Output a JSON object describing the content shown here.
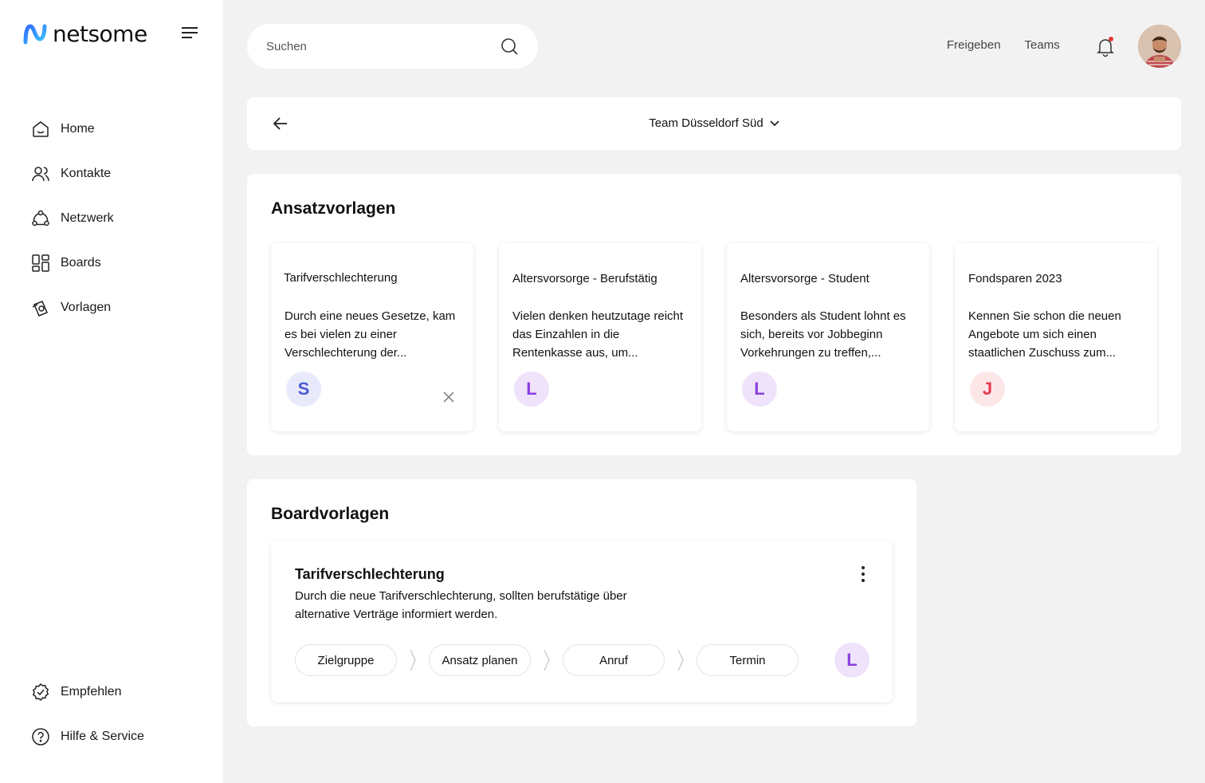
{
  "brand": {
    "name": "netsome"
  },
  "sidebar": {
    "items": [
      {
        "label": "Home",
        "icon": "home-icon"
      },
      {
        "label": "Kontakte",
        "icon": "contacts-icon"
      },
      {
        "label": "Netzwerk",
        "icon": "network-icon"
      },
      {
        "label": "Boards",
        "icon": "boards-icon"
      },
      {
        "label": "Vorlagen",
        "icon": "templates-icon"
      }
    ],
    "bottom_items": [
      {
        "label": "Empfehlen",
        "icon": "recommend-icon"
      },
      {
        "label": "Hilfe & Service",
        "icon": "help-icon"
      }
    ]
  },
  "search": {
    "placeholder": "Suchen"
  },
  "topnav": {
    "share": "Freigeben",
    "teams": "Teams"
  },
  "team": {
    "name": "Team Düsseldorf Süd"
  },
  "approach_templates": {
    "title": "Ansatzvorlagen",
    "cards": [
      {
        "title": "Tarifverschlechterung",
        "text": "Durch eine neues Gesetze, kam es bei vielen zu einer Verschlechterung der...",
        "initial": "S",
        "initial_color": "#4a5bd4",
        "initial_bg": "#e8eafb"
      },
      {
        "title": "Altersvorsorge - Berufstätig",
        "text": "Vielen denken heutzutage reicht das Einzahlen in die Rentenkasse aus, um...",
        "initial": "L",
        "initial_color": "#8a3ee0",
        "initial_bg": "#efe3fb"
      },
      {
        "title": "Altersvorsorge - Student",
        "text": "Besonders als Student lohnt es sich, bereits vor Jobbeginn Vorkehrungen zu treffen,...",
        "initial": "L",
        "initial_color": "#8a3ee0",
        "initial_bg": "#efe3fb"
      },
      {
        "title": "Fondsparen 2023",
        "text": "Kennen Sie schon die neuen Angebote um sich einen staatlichen Zuschuss zum...",
        "initial": "J",
        "initial_color": "#e5394d",
        "initial_bg": "#fde6e8"
      }
    ]
  },
  "board_templates": {
    "title": "Boardvorlagen",
    "board": {
      "title": "Tarifverschlechterung",
      "description": "Durch die neue Tarifverschlechterung, sollten berufstätige über alternative Verträge informiert werden.",
      "steps": [
        "Zielgruppe",
        "Ansatz planen",
        "Anruf",
        "Termin"
      ],
      "initial": "L",
      "initial_color": "#8a3ee0",
      "initial_bg": "#efe3fb"
    }
  },
  "colors": {
    "accent": "#2f6bff",
    "notification_dot": "#e53935"
  }
}
